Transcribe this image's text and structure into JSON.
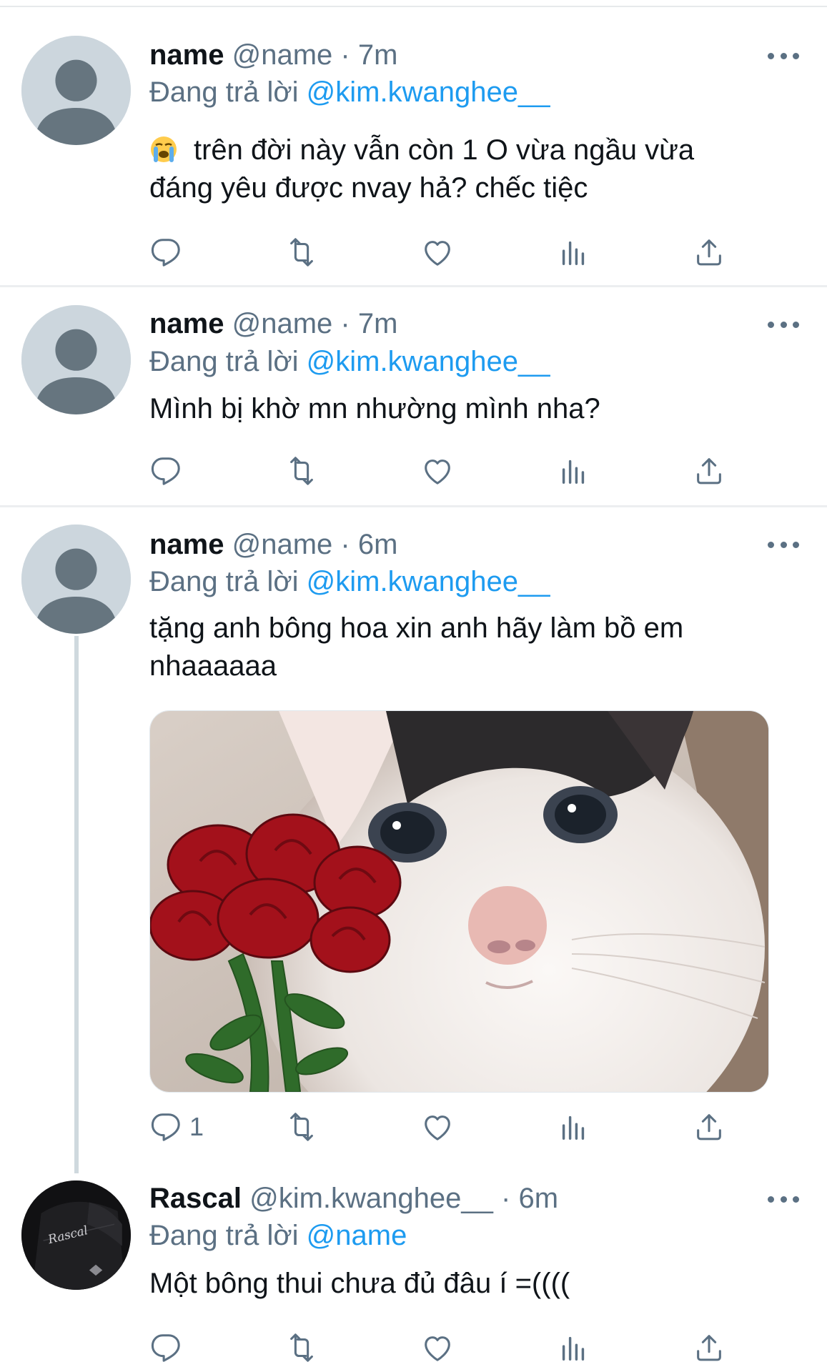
{
  "tweets": [
    {
      "name": "name",
      "handle": "@name",
      "dot": "·",
      "time": "7m",
      "reply_prefix": "Đang trả lời",
      "reply_to": "@kim.kwanghee__",
      "text": "trên đời này vẫn còn 1 O vừa ngầu vừa đáng yêu được nvay hả? chếc tiệc",
      "emoji": "loudly-crying-face",
      "avatar": "default-avatar"
    },
    {
      "name": "name",
      "handle": "@name",
      "dot": "·",
      "time": "7m",
      "reply_prefix": "Đang trả lời",
      "reply_to": "@kim.kwanghee__",
      "text": "Mình bị khờ mn nhường mình nha?",
      "avatar": "default-avatar"
    },
    {
      "name": "name",
      "handle": "@name",
      "dot": "·",
      "time": "6m",
      "reply_prefix": "Đang trả lời",
      "reply_to": "@kim.kwanghee__",
      "text": "tặng anh bông hoa xin anh hãy làm bồ em nhaaaaaa",
      "reply_count": "1",
      "media": "cat-with-roses-image",
      "avatar": "default-avatar"
    },
    {
      "name": "Rascal",
      "handle": "@kim.kwanghee__",
      "dot": "·",
      "time": "6m",
      "reply_prefix": "Đang trả lời",
      "reply_to": "@name",
      "text": "Một bông thui chưa đủ đâu í =((((",
      "avatar": "rascal-jersey-avatar"
    }
  ],
  "icons": [
    "reply-icon",
    "retweet-icon",
    "like-icon",
    "analytics-icon",
    "share-icon",
    "more-icon"
  ],
  "colors": {
    "link": "#1d9bf0",
    "secondary": "#5b7083",
    "divider": "#eceef0",
    "avatar_bg": "#ccd6dd"
  }
}
